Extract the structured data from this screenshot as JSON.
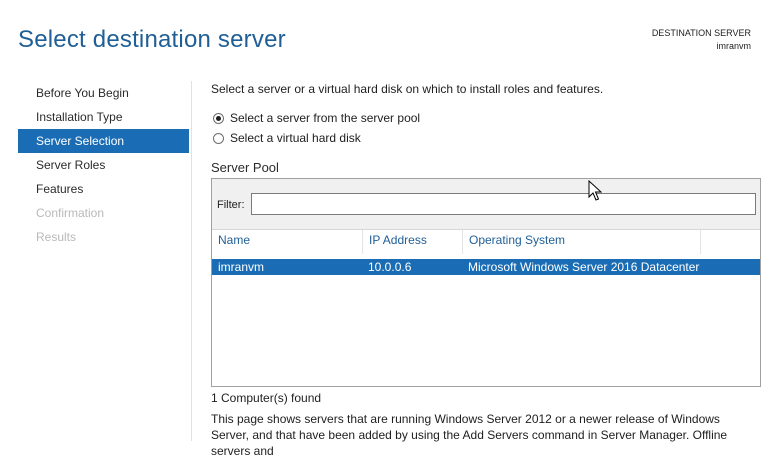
{
  "header": {
    "title": "Select destination server",
    "destination_label": "DESTINATION SERVER",
    "destination_value": "imranvm"
  },
  "nav": {
    "items": [
      {
        "label": "Before You Begin",
        "state": "normal"
      },
      {
        "label": "Installation Type",
        "state": "normal"
      },
      {
        "label": "Server Selection",
        "state": "active"
      },
      {
        "label": "Server Roles",
        "state": "normal"
      },
      {
        "label": "Features",
        "state": "normal"
      },
      {
        "label": "Confirmation",
        "state": "disabled"
      },
      {
        "label": "Results",
        "state": "disabled"
      }
    ]
  },
  "main": {
    "intro": "Select a server or a virtual hard disk on which to install roles and features.",
    "options": [
      {
        "label": "Select a server from the server pool",
        "checked": true
      },
      {
        "label": "Select a virtual hard disk",
        "checked": false
      }
    ],
    "pool_label": "Server Pool",
    "filter_label": "Filter:",
    "filter_value": "",
    "columns": [
      "Name",
      "IP Address",
      "Operating System"
    ],
    "rows": [
      {
        "name": "imranvm",
        "ip": "10.0.0.6",
        "os": "Microsoft Windows Server 2016 Datacenter",
        "selected": true
      }
    ],
    "found": "1 Computer(s) found",
    "description": "This page shows servers that are running Windows Server 2012 or a newer release of Windows Server, and that have been added by using the Add Servers command in Server Manager. Offline servers and"
  },
  "colors": {
    "accent": "#1a6db4",
    "title": "#1f5f96",
    "disabled_text": "#b9b9b9"
  },
  "icons": {
    "cursor": "mouse-pointer-icon"
  }
}
